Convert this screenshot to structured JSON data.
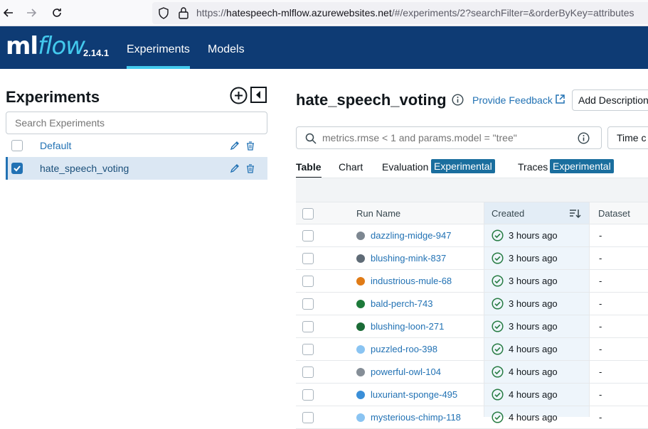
{
  "browser": {
    "url_prefix": "https://",
    "url_host": "hatespeech-mlflow.azurewebsites.net",
    "url_path": "/#/experiments/2?searchFilter=&orderByKey=attributes"
  },
  "header": {
    "logo_ml": "ml",
    "logo_flow": "flow",
    "version": "2.14.1",
    "tabs": [
      {
        "label": "Experiments"
      },
      {
        "label": "Models"
      }
    ]
  },
  "sidebar": {
    "title": "Experiments",
    "search_placeholder": "Search Experiments",
    "experiments": [
      {
        "name": "Default",
        "checked": false
      },
      {
        "name": "hate_speech_voting",
        "checked": true
      }
    ]
  },
  "main": {
    "title": "hate_speech_voting",
    "feedback_label": "Provide Feedback",
    "add_description_label": "Add Description",
    "filter_placeholder": "metrics.rmse < 1 and params.model = \"tree\"",
    "time_label": "Time c",
    "view_tabs": [
      {
        "label": "Table"
      },
      {
        "label": "Chart"
      },
      {
        "label": "Evaluation"
      },
      {
        "label": "Traces"
      }
    ],
    "experimental_badge": "Experimental",
    "table": {
      "columns": [
        "Run Name",
        "Created",
        "Dataset"
      ],
      "rows": [
        {
          "name": "dazzling-midge-947",
          "created": "3 hours ago",
          "dataset": "-",
          "color": "#7d8791"
        },
        {
          "name": "blushing-mink-837",
          "created": "3 hours ago",
          "dataset": "-",
          "color": "#5f6b76"
        },
        {
          "name": "industrious-mule-68",
          "created": "3 hours ago",
          "dataset": "-",
          "color": "#e07b16"
        },
        {
          "name": "bald-perch-743",
          "created": "3 hours ago",
          "dataset": "-",
          "color": "#1d7a3a"
        },
        {
          "name": "blushing-loon-271",
          "created": "3 hours ago",
          "dataset": "-",
          "color": "#1b6b36"
        },
        {
          "name": "puzzled-roo-398",
          "created": "4 hours ago",
          "dataset": "-",
          "color": "#8ac4f2"
        },
        {
          "name": "powerful-owl-104",
          "created": "4 hours ago",
          "dataset": "-",
          "color": "#858e97"
        },
        {
          "name": "luxuriant-sponge-495",
          "created": "4 hours ago",
          "dataset": "-",
          "color": "#3a8fd8"
        },
        {
          "name": "mysterious-chimp-118",
          "created": "4 hours ago",
          "dataset": "-",
          "color": "#8ac4f2"
        }
      ]
    }
  },
  "colors": {
    "header_bg": "#0e3b74",
    "accent": "#43c9ed",
    "link": "#2272b4",
    "badge": "#1a6e9e",
    "success": "#277c43"
  }
}
